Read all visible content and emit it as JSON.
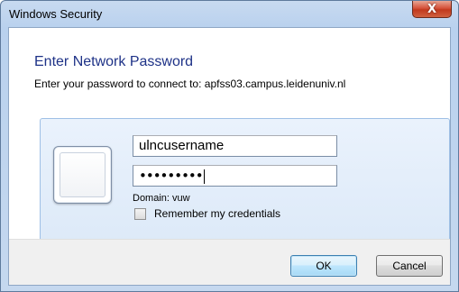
{
  "window": {
    "title": "Windows Security",
    "close_glyph": "X"
  },
  "dialog": {
    "heading": "Enter Network Password",
    "subheading": "Enter your password to connect to: apfss03.campus.leidenuniv.nl"
  },
  "credentials": {
    "username": "ulncusername",
    "password_mask": "•••••••••",
    "domain_label": "Domain: vuw",
    "remember_label": "Remember my credentials",
    "remember_checked": false,
    "tile_icon": "user-tile-icon"
  },
  "buttons": {
    "ok_label": "OK",
    "cancel_label": "Cancel"
  },
  "colors": {
    "heading": "#1e3287",
    "close_button": "#c1391d",
    "panel": "#dce9f8"
  }
}
